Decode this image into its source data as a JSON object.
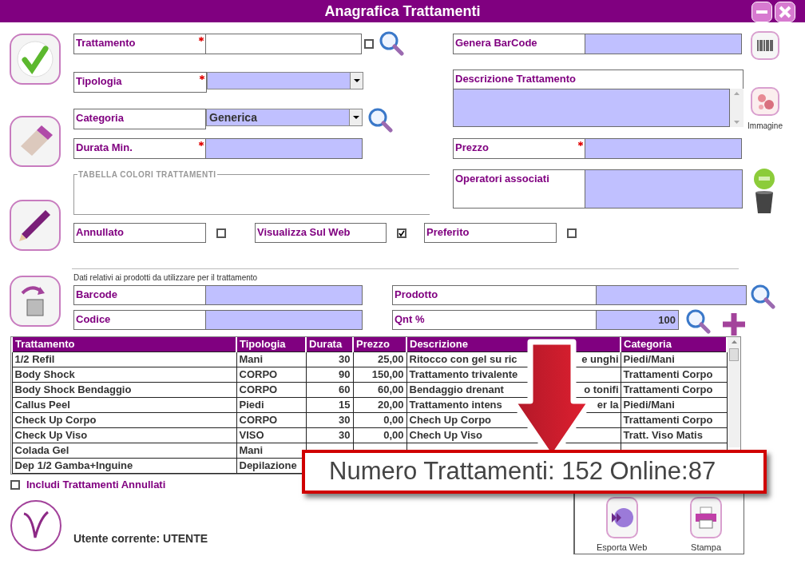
{
  "window": {
    "title": "Anagrafica Trattamenti"
  },
  "trattamento": {
    "label": "Trattamento",
    "required": true,
    "focused": true,
    "search_checked": false
  },
  "tipologia": {
    "label": "Tipologia",
    "required": true
  },
  "categoria": {
    "label": "Categoria",
    "value": "Generica"
  },
  "durata": {
    "label": "Durata Min.",
    "required": true
  },
  "tabella_colori": {
    "legend": "TABELLA COLORI TRATTAMENTI"
  },
  "genera_barcode": {
    "label": "Genera BarCode"
  },
  "descrizione": {
    "label": "Descrizione Trattamento"
  },
  "immagine": {
    "label": "Immagine"
  },
  "prezzo": {
    "label": "Prezzo",
    "required": true
  },
  "operatori": {
    "label": "Operatori associati"
  },
  "flags": [
    {
      "label": "Annullato",
      "checked": false
    },
    {
      "label": "Visualizza Sul Web",
      "checked": true
    },
    {
      "label": "Preferito",
      "checked": false
    }
  ],
  "prodotti": {
    "caption": "Dati relativi ai prodotti da utilizzare per il trattamento",
    "barcode": {
      "label": "Barcode"
    },
    "prodotto": {
      "label": "Prodotto"
    },
    "codice": {
      "label": "Codice"
    },
    "qnt": {
      "label": "Qnt %",
      "value": "100"
    }
  },
  "table": {
    "columns": [
      "Trattamento",
      "Tipologia",
      "Durata",
      "Prezzo",
      "Descrizione",
      "Categoria"
    ],
    "rows": [
      {
        "cells": [
          "1/2 Refil",
          "Mani",
          "30",
          "25,00",
          "Ritocco con gel su ric",
          "Piedi/Mani"
        ],
        "description_tail": "e unghi"
      },
      {
        "cells": [
          "Body Shock",
          "CORPO",
          "90",
          "150,00",
          "Trattamento trivalente",
          "Trattamenti Corpo"
        ]
      },
      {
        "cells": [
          "Body Shock Bendaggio",
          "CORPO",
          "60",
          "60,00",
          "Bendaggio drenant",
          "Trattamenti Corpo"
        ],
        "description_tail": "o tonifi"
      },
      {
        "cells": [
          "Callus Peel",
          "Piedi",
          "15",
          "20,00",
          "Trattamento intens",
          "Piedi/Mani"
        ],
        "description_tail": "er la"
      },
      {
        "cells": [
          "Check Up Corpo",
          "CORPO",
          "30",
          "0,00",
          "Chech Up Corpo",
          "Trattamenti Corpo"
        ]
      },
      {
        "cells": [
          "Check Up Viso",
          "VISO",
          "30",
          "0,00",
          "Chech Up Viso",
          "Tratt. Viso Matis"
        ]
      },
      {
        "cells": [
          "Colada Gel",
          "Mani",
          "",
          "",
          "",
          ""
        ]
      },
      {
        "cells": [
          "Dep 1/2 Gamba+Inguine",
          "Depilazione",
          "",
          "",
          "",
          ""
        ]
      }
    ]
  },
  "includi_annullati": {
    "label": "Includi Trattamenti Annullati",
    "checked": false
  },
  "user": {
    "label": "Utente corrente: UTENTE"
  },
  "actions": [
    {
      "label": "Esporta Web",
      "kind": "web"
    },
    {
      "label": "Stampa",
      "kind": "print"
    }
  ],
  "callout": {
    "text": "Numero Trattamenti: 152 Online:87"
  }
}
